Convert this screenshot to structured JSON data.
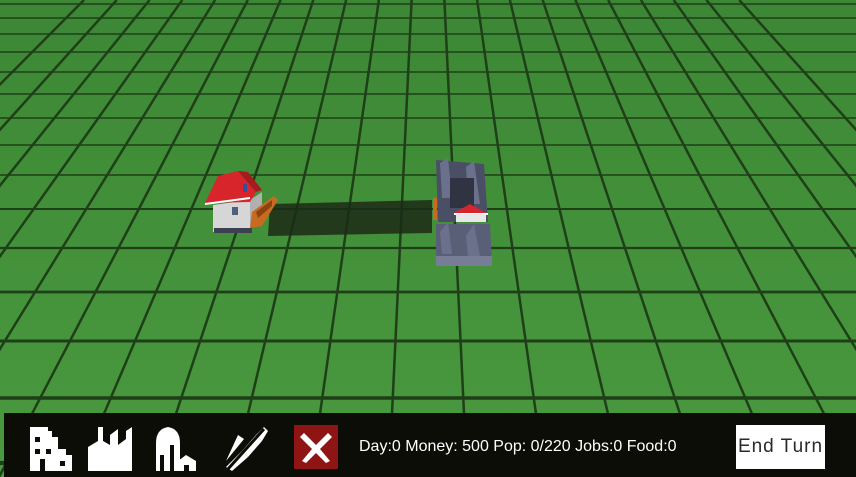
{
  "colors": {
    "grass": "#3e8a37",
    "grid_line": "#1f3f18",
    "toolbar": "#0b0d06",
    "delete_red": "#8f1414",
    "roof_red": "#d8252c",
    "steel_grey": "#5a5f78"
  },
  "toolbar": {
    "tools": [
      {
        "icon": "house-icon"
      },
      {
        "icon": "factory-icon"
      },
      {
        "icon": "farm-silo-icon"
      },
      {
        "icon": "road-remove-icon"
      },
      {
        "icon": "delete-x-icon",
        "glyph": "X"
      }
    ]
  },
  "stats": {
    "text": "Day:0 Money: 500 Pop: 0/220 Jobs:0 Food:0"
  },
  "end_turn_label": "End Turn"
}
